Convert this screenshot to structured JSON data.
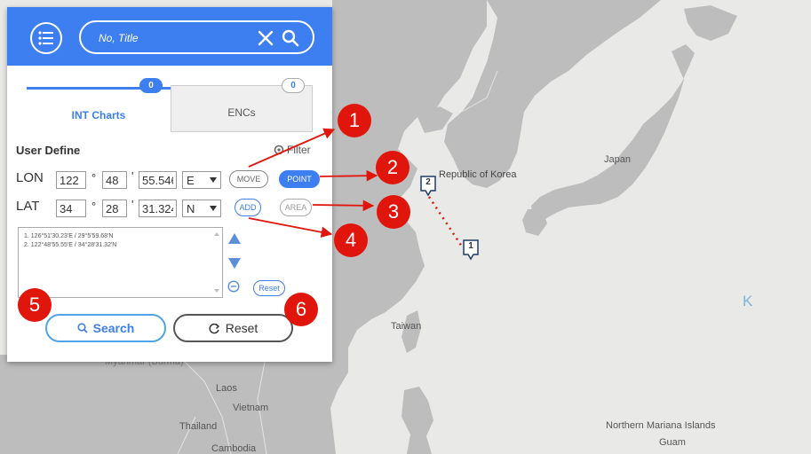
{
  "header": {
    "search_placeholder": "No, Title"
  },
  "tabs": [
    {
      "label": "INT Charts",
      "count": "0",
      "active": true
    },
    {
      "label": "ENCs",
      "count": "0",
      "active": false
    }
  ],
  "user_define": {
    "title": "User Define",
    "filter_label": "Filter",
    "lon": {
      "label": "LON",
      "deg": "122",
      "min": "48",
      "sec": "55.546",
      "dir": "E"
    },
    "lat": {
      "label": "LAT",
      "deg": "34",
      "min": "28",
      "sec": "31.324",
      "dir": "N"
    },
    "symbols": {
      "degree": "°",
      "minute": "'"
    },
    "buttons": {
      "move": "MOVE",
      "point": "POINT",
      "add": "ADD",
      "area": "AREA"
    },
    "coordinate_list": [
      "1. 126°51'30.23'E / 29°5'59.68'N",
      "2. 122°48'55.55'E / 34°28'31.32'N"
    ],
    "list_reset_label": "Reset"
  },
  "actions": {
    "search_label": "Search",
    "reset_label": "Reset"
  },
  "annotations": [
    "1",
    "2",
    "3",
    "4",
    "5",
    "6"
  ],
  "map": {
    "labels": {
      "korea": "Republic of Korea",
      "japan": "Japan",
      "taiwan": "Taiwan",
      "laos": "Laos",
      "vietnam": "Vietnam",
      "thailand": "Thailand",
      "cambodia": "Cambodia",
      "myanmar": "Myanmar (Burma)",
      "mariana": "Northern Mariana Islands",
      "guam": "Guam",
      "k": "K"
    },
    "markers": [
      "1",
      "2"
    ]
  },
  "colors": {
    "accent": "#3d7ef0",
    "annotation": "#e0160c",
    "land": "#bdbdbd",
    "sea": "#e9e9e7"
  }
}
